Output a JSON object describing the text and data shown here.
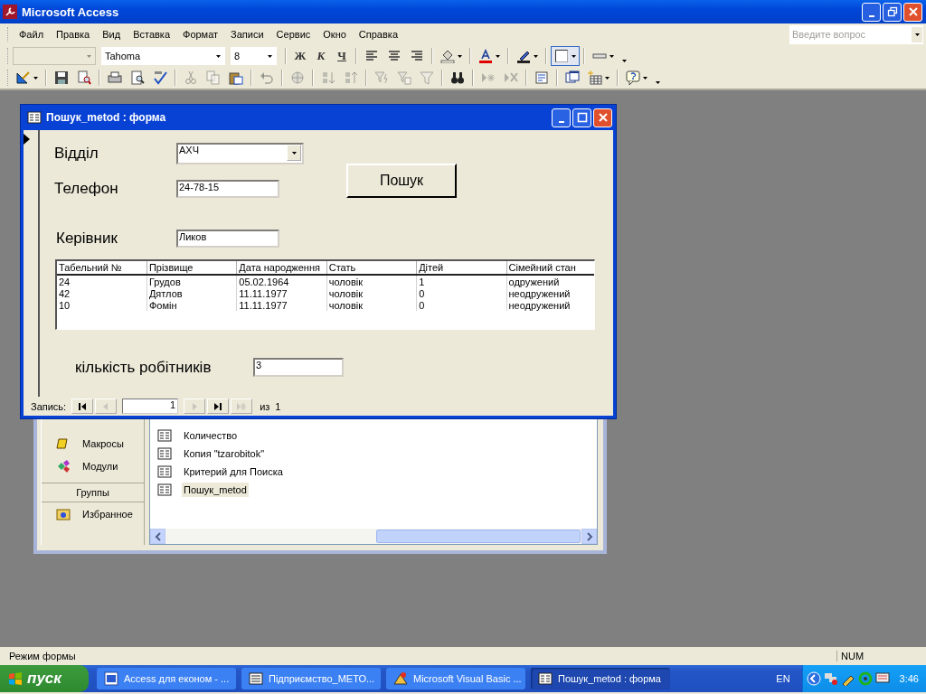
{
  "app": {
    "title": "Microsoft Access"
  },
  "menu": [
    {
      "label": "Файл"
    },
    {
      "label": "Правка"
    },
    {
      "label": "Вид"
    },
    {
      "label": "Вставка"
    },
    {
      "label": "Формат"
    },
    {
      "label": "Записи"
    },
    {
      "label": "Сервис"
    },
    {
      "label": "Окно"
    },
    {
      "label": "Справка"
    }
  ],
  "help_box": {
    "placeholder": "Введите вопрос"
  },
  "toolbar_1": [
    {
      "kind": "combo",
      "disabled": true
    },
    {
      "kind": "combo",
      "value": "Tahoma",
      "disabled": false
    },
    {
      "kind": "combo",
      "value": "8",
      "disabled": false
    },
    {
      "kind": "sep"
    },
    {
      "kind": "char",
      "label": "Ж"
    },
    {
      "kind": "char",
      "label": "К"
    },
    {
      "kind": "char",
      "label": "Ч"
    },
    {
      "kind": "sep"
    },
    {
      "kind": "icon",
      "disabled": false
    },
    {
      "kind": "icon",
      "disabled": false
    },
    {
      "kind": "icon",
      "disabled": false
    },
    {
      "kind": "sep"
    },
    {
      "kind": "icon",
      "disabled": false,
      "dropdown": true
    },
    {
      "kind": "sep"
    },
    {
      "kind": "icon",
      "disabled": false,
      "dropdown": true
    },
    {
      "kind": "sep"
    },
    {
      "kind": "icon",
      "disabled": false,
      "dropdown": true
    },
    {
      "kind": "sep"
    },
    {
      "kind": "icon",
      "disabled": false,
      "dropdown": true,
      "pressed": true
    },
    {
      "kind": "sep"
    },
    {
      "kind": "icon",
      "disabled": false,
      "dropdown": true
    },
    {
      "kind": "more"
    }
  ],
  "toolbar_2": [
    {
      "kind": "icon",
      "disabled": false,
      "dropdown": true
    },
    {
      "kind": "sep"
    },
    {
      "kind": "icon",
      "disabled": false
    },
    {
      "kind": "icon",
      "disabled": false
    },
    {
      "kind": "sep"
    },
    {
      "kind": "icon",
      "disabled": false
    },
    {
      "kind": "icon",
      "disabled": false
    },
    {
      "kind": "icon",
      "disabled": false
    },
    {
      "kind": "sep"
    },
    {
      "kind": "icon",
      "disabled": true
    },
    {
      "kind": "icon",
      "disabled": true
    },
    {
      "kind": "icon",
      "disabled": false
    },
    {
      "kind": "sep"
    },
    {
      "kind": "icon",
      "disabled": true
    },
    {
      "kind": "sep"
    },
    {
      "kind": "icon",
      "disabled": true
    },
    {
      "kind": "sep"
    },
    {
      "kind": "icon",
      "disabled": true
    },
    {
      "kind": "icon",
      "disabled": true
    },
    {
      "kind": "sep"
    },
    {
      "kind": "icon",
      "disabled": true
    },
    {
      "kind": "icon",
      "disabled": true
    },
    {
      "kind": "icon",
      "disabled": true
    },
    {
      "kind": "sep"
    },
    {
      "kind": "icon",
      "disabled": false
    },
    {
      "kind": "sep"
    },
    {
      "kind": "icon",
      "disabled": true
    },
    {
      "kind": "icon",
      "disabled": true
    },
    {
      "kind": "sep"
    },
    {
      "kind": "icon",
      "disabled": false
    },
    {
      "kind": "sep"
    },
    {
      "kind": "icon",
      "disabled": false
    },
    {
      "kind": "icon",
      "disabled": false,
      "dropdown": true
    },
    {
      "kind": "sep"
    },
    {
      "kind": "icon",
      "disabled": false,
      "dropdown": true
    },
    {
      "kind": "more"
    }
  ],
  "form": {
    "title": "Пошук_metod : форма",
    "fields": [
      {
        "label": "Відділ",
        "kind": "combo",
        "value": "АХЧ"
      },
      {
        "label": "Телефон",
        "kind": "text",
        "value": "24-78-15"
      },
      {
        "label": "Керівник",
        "kind": "text",
        "value": "Ликов"
      }
    ],
    "search_button": "Пошук",
    "table": {
      "columns": [
        "Табельний №",
        "Прізвище",
        "Дата народження",
        "Стать",
        "Дітей",
        "Сімейний стан"
      ],
      "rows": [
        [
          "24",
          "Грудов",
          "05.02.1964",
          "чоловік",
          "1",
          "одружений"
        ],
        [
          "42",
          "Дятлов",
          "11.11.1977",
          "чоловік",
          "0",
          "неодружений"
        ],
        [
          "10",
          "Фомін",
          "11.11.1977",
          "чоловік",
          "0",
          "неодружений"
        ]
      ]
    },
    "count": {
      "label": "кількість робітників",
      "value": "3"
    },
    "navigator": {
      "label": "Запись:",
      "current": "1",
      "of": "из",
      "total": "1"
    }
  },
  "db_window": {
    "objects": [
      {
        "label": "Макросы"
      },
      {
        "label": "Модули"
      }
    ],
    "groups_header": "Группы",
    "groups": [
      {
        "label": "Избранное"
      }
    ],
    "items": [
      {
        "label": "Количество",
        "selected": false
      },
      {
        "label": "Копия \"tzarobitok\"",
        "selected": false
      },
      {
        "label": "Критерий для Поиска",
        "selected": false
      },
      {
        "label": "Пошук_metod",
        "selected": true
      }
    ]
  },
  "status_bar": {
    "mode": "Режим формы",
    "num": "NUM"
  },
  "taskbar": {
    "start": "пуск",
    "tasks": [
      {
        "label": "Access для економ - ...",
        "selected": false
      },
      {
        "label": "Підприємство_МЕТО...",
        "selected": false
      },
      {
        "label": "Microsoft Visual Basic ...",
        "selected": false
      },
      {
        "label": "Пошук_metod : форма",
        "selected": true
      }
    ],
    "language": "EN",
    "clock": "3:46"
  }
}
